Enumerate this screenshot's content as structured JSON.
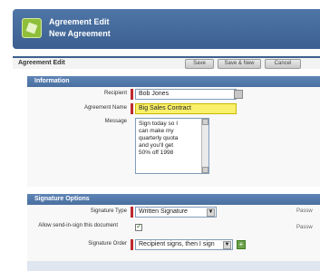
{
  "header": {
    "title": "Agreement Edit",
    "subtitle": "New Agreement"
  },
  "detail": {
    "title": "Agreement Edit",
    "buttons": [
      "Save",
      "Save & New",
      "Cancel"
    ]
  },
  "sections": {
    "information": "Information",
    "signature_options": "Signature Options"
  },
  "information": {
    "recipient_label": "Recipient",
    "recipient_value": "Bob Jones",
    "agreement_name_label": "Agreement Name",
    "agreement_name_value": "Big Sales Contract",
    "message_label": "Message",
    "message_lines": [
      "Sign today so I",
      "can make my",
      "quarterly quota",
      "and you'll get",
      "50% off 1998"
    ]
  },
  "signature": {
    "type_label": "Signature Type",
    "type_value": "Written Signature",
    "hosted_label": "Allow send-in-sign this document",
    "hosted_checked": true,
    "order_label": "Signature Order",
    "order_value": "Recipient signs, then I sign",
    "right_label_1": "Passw",
    "right_label_2": "Passw"
  },
  "colors": {
    "header_blue": "#3b5f8f",
    "required_red": "#c0282d",
    "highlight_yellow": "#f9f06b"
  }
}
